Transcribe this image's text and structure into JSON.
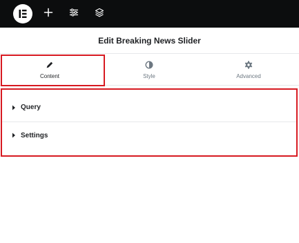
{
  "topbar": {
    "logo_icon": "elementor-logo-icon",
    "add_icon": "plus-icon",
    "settings_icon": "sliders-icon",
    "structure_icon": "layers-icon"
  },
  "panel": {
    "title": "Edit Breaking News Slider"
  },
  "tabs": [
    {
      "label": "Content",
      "icon": "pencil-icon",
      "active": true
    },
    {
      "label": "Style",
      "icon": "half-circle-icon",
      "active": false
    },
    {
      "label": "Advanced",
      "icon": "gear-icon",
      "active": false
    }
  ],
  "sections": [
    {
      "label": "Query",
      "icon": "caret-right-icon"
    },
    {
      "label": "Settings",
      "icon": "caret-right-icon"
    }
  ],
  "colors": {
    "topbar_bg": "#0c0d0e",
    "highlight": "#d71920",
    "text": "#1f2124",
    "muted": "#6d7882"
  }
}
